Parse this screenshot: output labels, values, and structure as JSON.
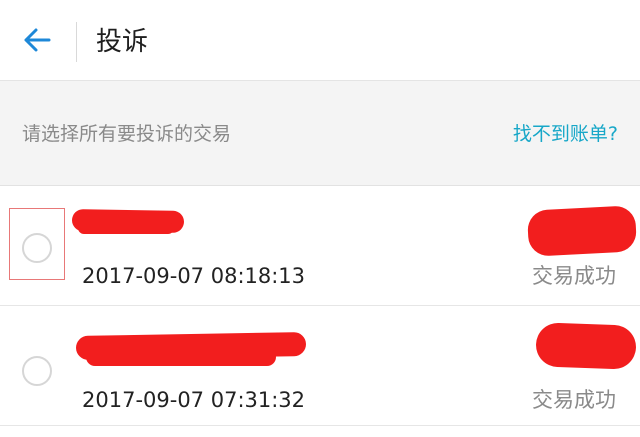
{
  "header": {
    "title": "投诉",
    "back_icon": "arrow-left-icon",
    "accent_color": "#1e88d8"
  },
  "notice": {
    "prompt": "请选择所有要投诉的交易",
    "link": "找不到账单?",
    "link_color": "#17a7c8"
  },
  "transactions": [
    {
      "time": "2017-09-07 08:18:13",
      "status": "交易成功",
      "title": "",
      "amount": "",
      "selected": false
    },
    {
      "time": "2017-09-07 07:31:32",
      "status": "交易成功",
      "title": "",
      "amount": "",
      "selected": false
    }
  ]
}
